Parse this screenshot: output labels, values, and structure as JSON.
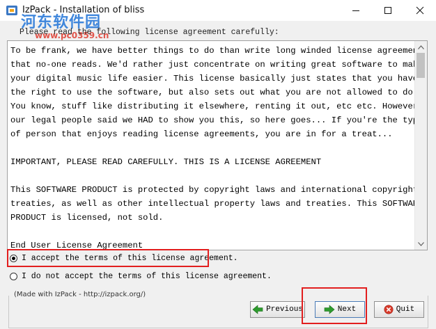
{
  "window": {
    "title": "IzPack - Installation of bliss"
  },
  "watermark": {
    "logo_text": "河东软件园",
    "url": "www.pc0359.cn"
  },
  "prompt": "Please read the following license agreement carefully:",
  "license_lines": [
    "To be frank, we have better things to do than write long winded license agreements",
    "that no-one reads. We'd rather just concentrate on writing great software to make",
    "your digital music life easier. This license basically just states that you have",
    "the right to use the software, but also sets out what you are not allowed to do.",
    "You know, stuff like distributing it elsewhere, renting it out, etc etc. However,",
    "our legal people said we HAD to show you this, so here goes... If you're the type",
    "of person that enjoys reading license agreements, you are in for a treat...",
    "",
    "IMPORTANT, PLEASE READ CAREFULLY. THIS IS A LICENSE AGREEMENT",
    "",
    "This SOFTWARE PRODUCT is protected by copyright laws and international copyright",
    "treaties, as well as other intellectual property laws and treaties. This SOFTWARE",
    "PRODUCT is licensed, not sold.",
    "",
    "End User License Agreement"
  ],
  "options": {
    "accept": {
      "label": "I accept the terms of this license agreement.",
      "selected": true
    },
    "decline": {
      "label": "I do not accept the terms of this license agreement.",
      "selected": false
    }
  },
  "footer": {
    "made_with": "(Made with IzPack - http://izpack.org/)"
  },
  "buttons": {
    "previous": "Previous",
    "next": "Next",
    "quit": "Quit"
  },
  "colors": {
    "highlight": "#e21e1e",
    "next_arrow": "#2e9b2e",
    "quit_icon": "#d83a2a"
  }
}
